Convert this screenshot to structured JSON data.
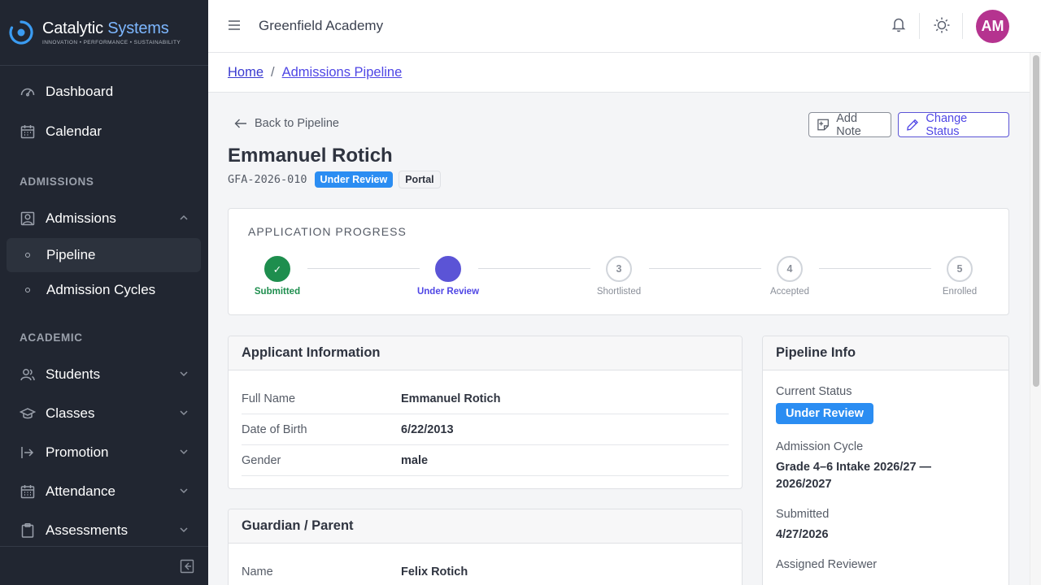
{
  "brand": {
    "name_primary": "Catalytic",
    "name_accent": "Systems",
    "tagline": "INNOVATION • PERFORMANCE • SUSTAINABILITY"
  },
  "sidebar": {
    "items": [
      {
        "label": "Dashboard",
        "icon": "gauge-icon"
      },
      {
        "label": "Calendar",
        "icon": "calendar-icon"
      }
    ],
    "sections": [
      {
        "title": "ADMISSIONS",
        "items": [
          {
            "label": "Admissions",
            "icon": "admissions-icon",
            "expanded": true
          },
          {
            "label": "Pipeline",
            "sub": true,
            "active": true
          },
          {
            "label": "Admission Cycles",
            "sub": true
          }
        ]
      },
      {
        "title": "ACADEMIC",
        "items": [
          {
            "label": "Students",
            "icon": "students-icon"
          },
          {
            "label": "Classes",
            "icon": "graduation-cap-icon"
          },
          {
            "label": "Promotion",
            "icon": "promotion-icon"
          },
          {
            "label": "Attendance",
            "icon": "calendar-check-icon"
          },
          {
            "label": "Assessments",
            "icon": "clipboard-icon"
          }
        ]
      }
    ]
  },
  "header": {
    "school_name": "Greenfield Academy",
    "avatar_initials": "AM"
  },
  "breadcrumb": {
    "home": "Home",
    "current": "Admissions Pipeline",
    "separator": "/"
  },
  "page": {
    "back_label": "Back to Pipeline",
    "add_note_label": "Add Note",
    "change_status_label": "Change Status",
    "applicant_name": "Emmanuel Rotich",
    "application_id": "GFA-2026-010",
    "status_badge": "Under Review",
    "source_badge": "Portal"
  },
  "progress": {
    "title": "APPLICATION PROGRESS",
    "steps": [
      {
        "label": "Submitted",
        "marker": "✓",
        "state": "done"
      },
      {
        "label": "Under Review",
        "marker": "",
        "state": "current"
      },
      {
        "label": "Shortlisted",
        "marker": "3",
        "state": "pending"
      },
      {
        "label": "Accepted",
        "marker": "4",
        "state": "pending"
      },
      {
        "label": "Enrolled",
        "marker": "5",
        "state": "pending"
      }
    ]
  },
  "applicant": {
    "title": "Applicant Information",
    "rows": [
      {
        "label": "Full Name",
        "value": "Emmanuel Rotich"
      },
      {
        "label": "Date of Birth",
        "value": "6/22/2013"
      },
      {
        "label": "Gender",
        "value": "male"
      }
    ]
  },
  "guardian": {
    "title": "Guardian / Parent",
    "rows": [
      {
        "label": "Name",
        "value": "Felix Rotich"
      }
    ]
  },
  "pipeline_info": {
    "title": "Pipeline Info",
    "current_status_label": "Current Status",
    "current_status": "Under Review",
    "cycle_label": "Admission Cycle",
    "cycle_value": "Grade 4–6 Intake 2026/27 — 2026/2027",
    "submitted_label": "Submitted",
    "submitted_value": "4/27/2026",
    "reviewer_label": "Assigned Reviewer"
  },
  "colors": {
    "sidebar_bg": "#212631",
    "accent": "#4f46e5",
    "status_blue": "#2b8df2",
    "success": "#1e8e4e",
    "avatar": "#b5338f"
  }
}
